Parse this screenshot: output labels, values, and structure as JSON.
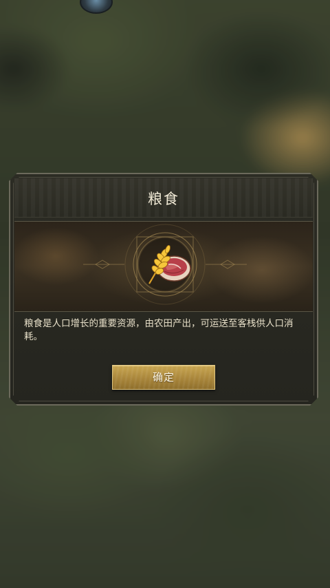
{
  "dialog": {
    "title": "粮食",
    "item_icon": "grain-meat-icon",
    "description": "粮食是人口增长的重要资源，由农田产出，可运送至客栈供人口消耗。",
    "confirm_label": "确定"
  },
  "colors": {
    "button_gold": "#b8943f",
    "title_text": "#f1ead6",
    "panel_bg": "#2a2a22"
  }
}
